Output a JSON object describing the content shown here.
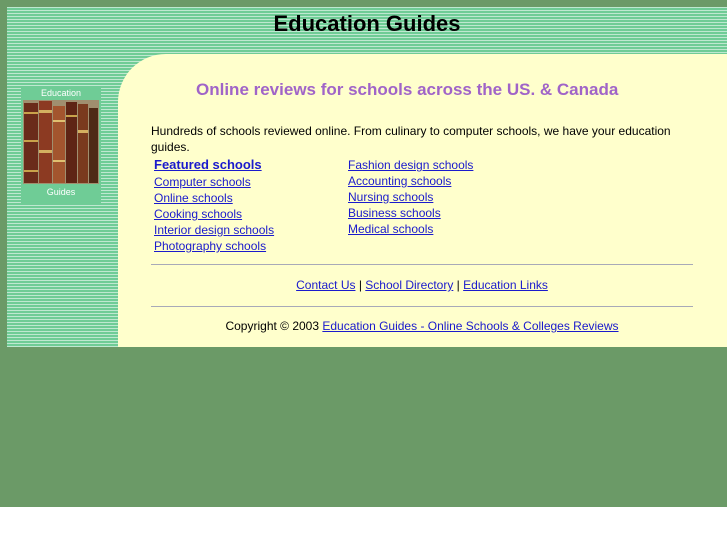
{
  "site": {
    "title": "Education Guides"
  },
  "logo": {
    "top_text": "Education",
    "bottom_text": "Guides"
  },
  "main": {
    "headline": "Online reviews for schools across the US. & Canada",
    "intro": "Hundreds of schools reviewed online. From culinary to computer schools, we have your education guides.",
    "links_left": [
      "Featured schools",
      "Computer schools",
      "Online schools",
      "Cooking schools",
      "Interior design schools",
      "Photography schools"
    ],
    "links_right": [
      "Fashion design schools",
      "Accounting schools",
      "Nursing schools",
      "Business schools",
      "Medical schools"
    ]
  },
  "footer": {
    "contact": "Contact Us",
    "directory": "School Directory",
    "links": "Education Links",
    "separator": "|",
    "copyright_prefix": "Copyright © 2003",
    "copyright_link": "Education Guides - Online Schools & Colleges Reviews"
  },
  "colors": {
    "page_bg": "#6b9a67",
    "frame_green": "#6fcc96",
    "content_bg": "#ffffcc",
    "headline": "#a064c8",
    "link": "#1a1acc"
  }
}
